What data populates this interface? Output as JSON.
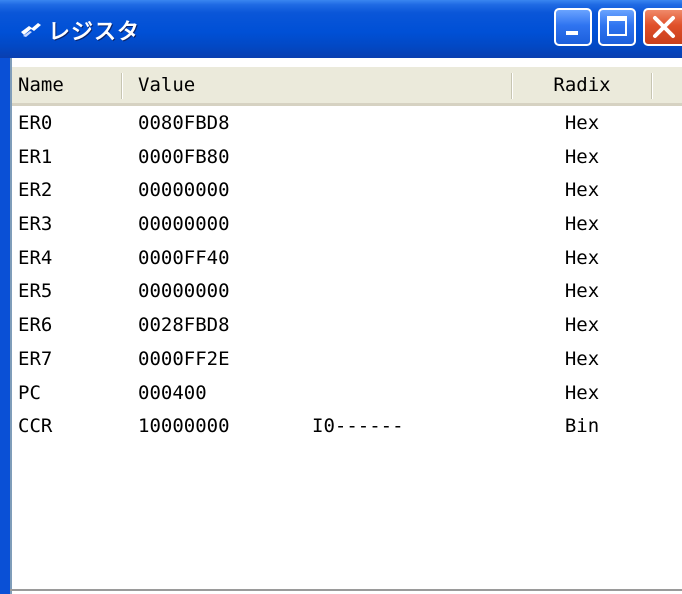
{
  "window": {
    "title": "レジスタ",
    "icon": "register-window-icon"
  },
  "colors": {
    "titlebar": "#0050d6",
    "header_bg": "#ebeadb",
    "close_button": "#e0502a"
  },
  "columns": {
    "name": "Name",
    "value": "Value",
    "radix": "Radix"
  },
  "registers": [
    {
      "name": "ER0",
      "value": "0080FBD8",
      "flags": "",
      "radix": "Hex"
    },
    {
      "name": "ER1",
      "value": "0000FB80",
      "flags": "",
      "radix": "Hex"
    },
    {
      "name": "ER2",
      "value": "00000000",
      "flags": "",
      "radix": "Hex"
    },
    {
      "name": "ER3",
      "value": "00000000",
      "flags": "",
      "radix": "Hex"
    },
    {
      "name": "ER4",
      "value": "0000FF40",
      "flags": "",
      "radix": "Hex"
    },
    {
      "name": "ER5",
      "value": "00000000",
      "flags": "",
      "radix": "Hex"
    },
    {
      "name": "ER6",
      "value": "0028FBD8",
      "flags": "",
      "radix": "Hex"
    },
    {
      "name": "ER7",
      "value": "0000FF2E",
      "flags": "",
      "radix": "Hex"
    },
    {
      "name": "PC",
      "value": "000400",
      "flags": "",
      "radix": "Hex"
    },
    {
      "name": "CCR",
      "value": "10000000",
      "flags": "I0------",
      "radix": "Bin"
    }
  ]
}
